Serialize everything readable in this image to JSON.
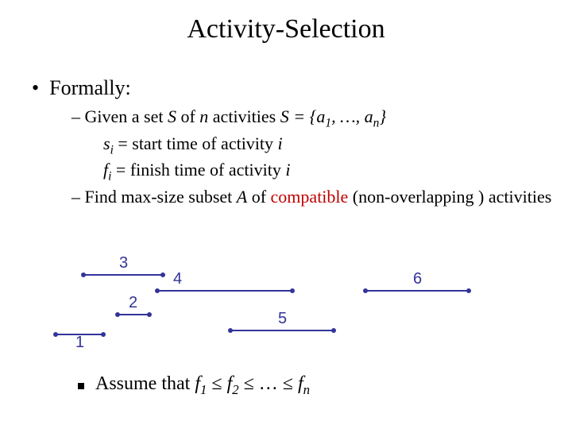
{
  "title": "Activity-Selection",
  "bullet1": "Formally:",
  "given_prefix": "– Given a set ",
  "given_S": "S",
  "given_of": " of ",
  "given_n": "n",
  "given_act": " activities ",
  "given_eq": " = {",
  "given_a": "a",
  "given_sub1": "1",
  "given_dots": ", …, ",
  "given_subn": "n",
  "given_close": "}",
  "si_s": "s",
  "si_i": "i",
  "start_txt": " = start time of activity ",
  "fi_f": "f",
  "fi_i": "i",
  "finish_txt": " = finish time of activity ",
  "find_prefix": "– Find max-size subset ",
  "find_A": "A",
  "find_of": " of ",
  "compatible": "compatible",
  "find_rest": " (non-overlapping ) activities",
  "assume_pre": "Assume that ",
  "leq": " ≤ ",
  "dots": "… ",
  "f": "f",
  "s1": "1",
  "s2": "2",
  "sn": "n",
  "d1": "1",
  "d2": "2",
  "d3": "3",
  "d4": "4",
  "d5": "5",
  "d6": "6"
}
